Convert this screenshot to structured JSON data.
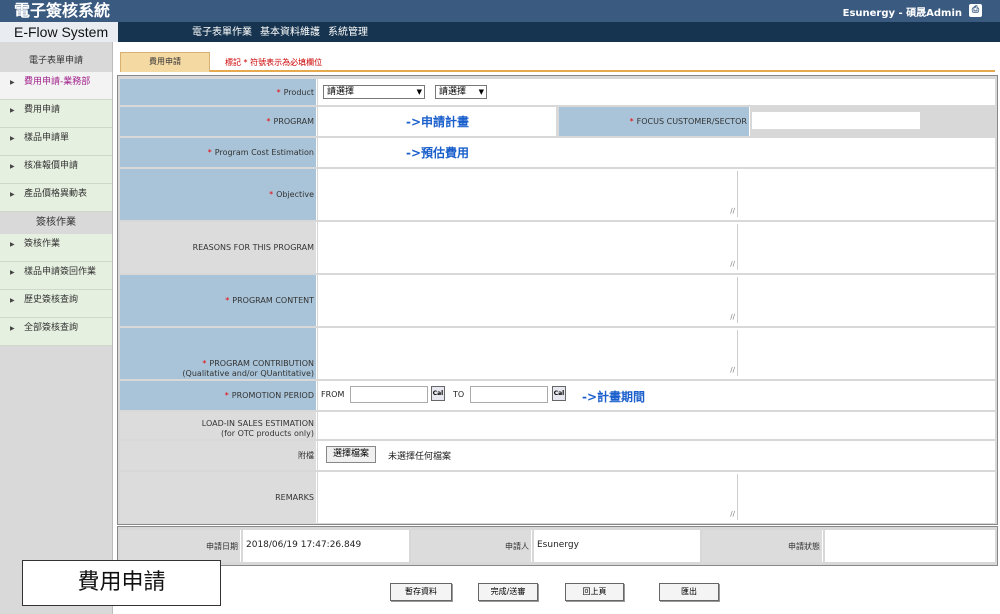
{
  "header": {
    "brand": "電子簽核系統",
    "user": "Esunergy - 碩晟Admin",
    "exit_icon": "exit-icon",
    "system_name": "E-Flow System",
    "menu": [
      "電子表單作業",
      "基本資料維護",
      "系統管理"
    ]
  },
  "sidebar": {
    "section1": "電子表單申請",
    "items1": [
      "費用申請-業務部",
      "費用申請",
      "樣品申請單",
      "核准報價申請",
      "產品價格異動表"
    ],
    "section2": "簽核作業",
    "items2": [
      "簽核作業",
      "樣品申請簽回作業",
      "歷史簽核查詢",
      "全部簽核查詢"
    ]
  },
  "tab": {
    "label": "費用申請",
    "note": "標記 * 符號表示為必填欄位"
  },
  "form": {
    "product": {
      "label": "Product",
      "select1": "請選擇",
      "select2": "請選擇"
    },
    "program": {
      "label": "PROGRAM",
      "hint": "->申請計畫"
    },
    "focus": {
      "label": "FOCUS CUSTOMER/SECTOR"
    },
    "cost": {
      "label": "Program Cost Estimation",
      "hint": "->預估費用"
    },
    "objective": {
      "label": "Objective"
    },
    "reasons": {
      "label": "REASONS FOR THIS PROGRAM"
    },
    "content": {
      "label": "PROGRAM CONTENT"
    },
    "contribution": {
      "label": "PROGRAM CONTRIBUTION",
      "sub": "(Qualitative and/or QUantitative)"
    },
    "promotion": {
      "label": "PROMOTION PERIOD",
      "from": "FROM",
      "to": "TO",
      "cal": "Cal",
      "hint": "->計畫期間"
    },
    "loadin": {
      "label": "LOAD-IN SALES ESTIMATION",
      "sub": "(for OTC products only)"
    },
    "attach": {
      "label": "附檔",
      "button": "選擇檔案",
      "status": "未選擇任何檔案"
    },
    "remarks": {
      "label": "REMARKS"
    }
  },
  "info": {
    "date_label": "申請日期",
    "date": "2018/06/19 17:47:26.849",
    "applicant_label": "申請人",
    "applicant": "Esunergy",
    "status_label": "申請狀態",
    "status": ""
  },
  "actions": [
    "暫存資料",
    "完成/送審",
    "回上頁",
    "匯出"
  ],
  "caption": "費用申請",
  "colors": {
    "topbar": "#3a5a80",
    "navbar": "#16344f",
    "label_blue": "#a9c4d8",
    "hint_blue": "#1a5fcc",
    "required": "#e00000"
  }
}
